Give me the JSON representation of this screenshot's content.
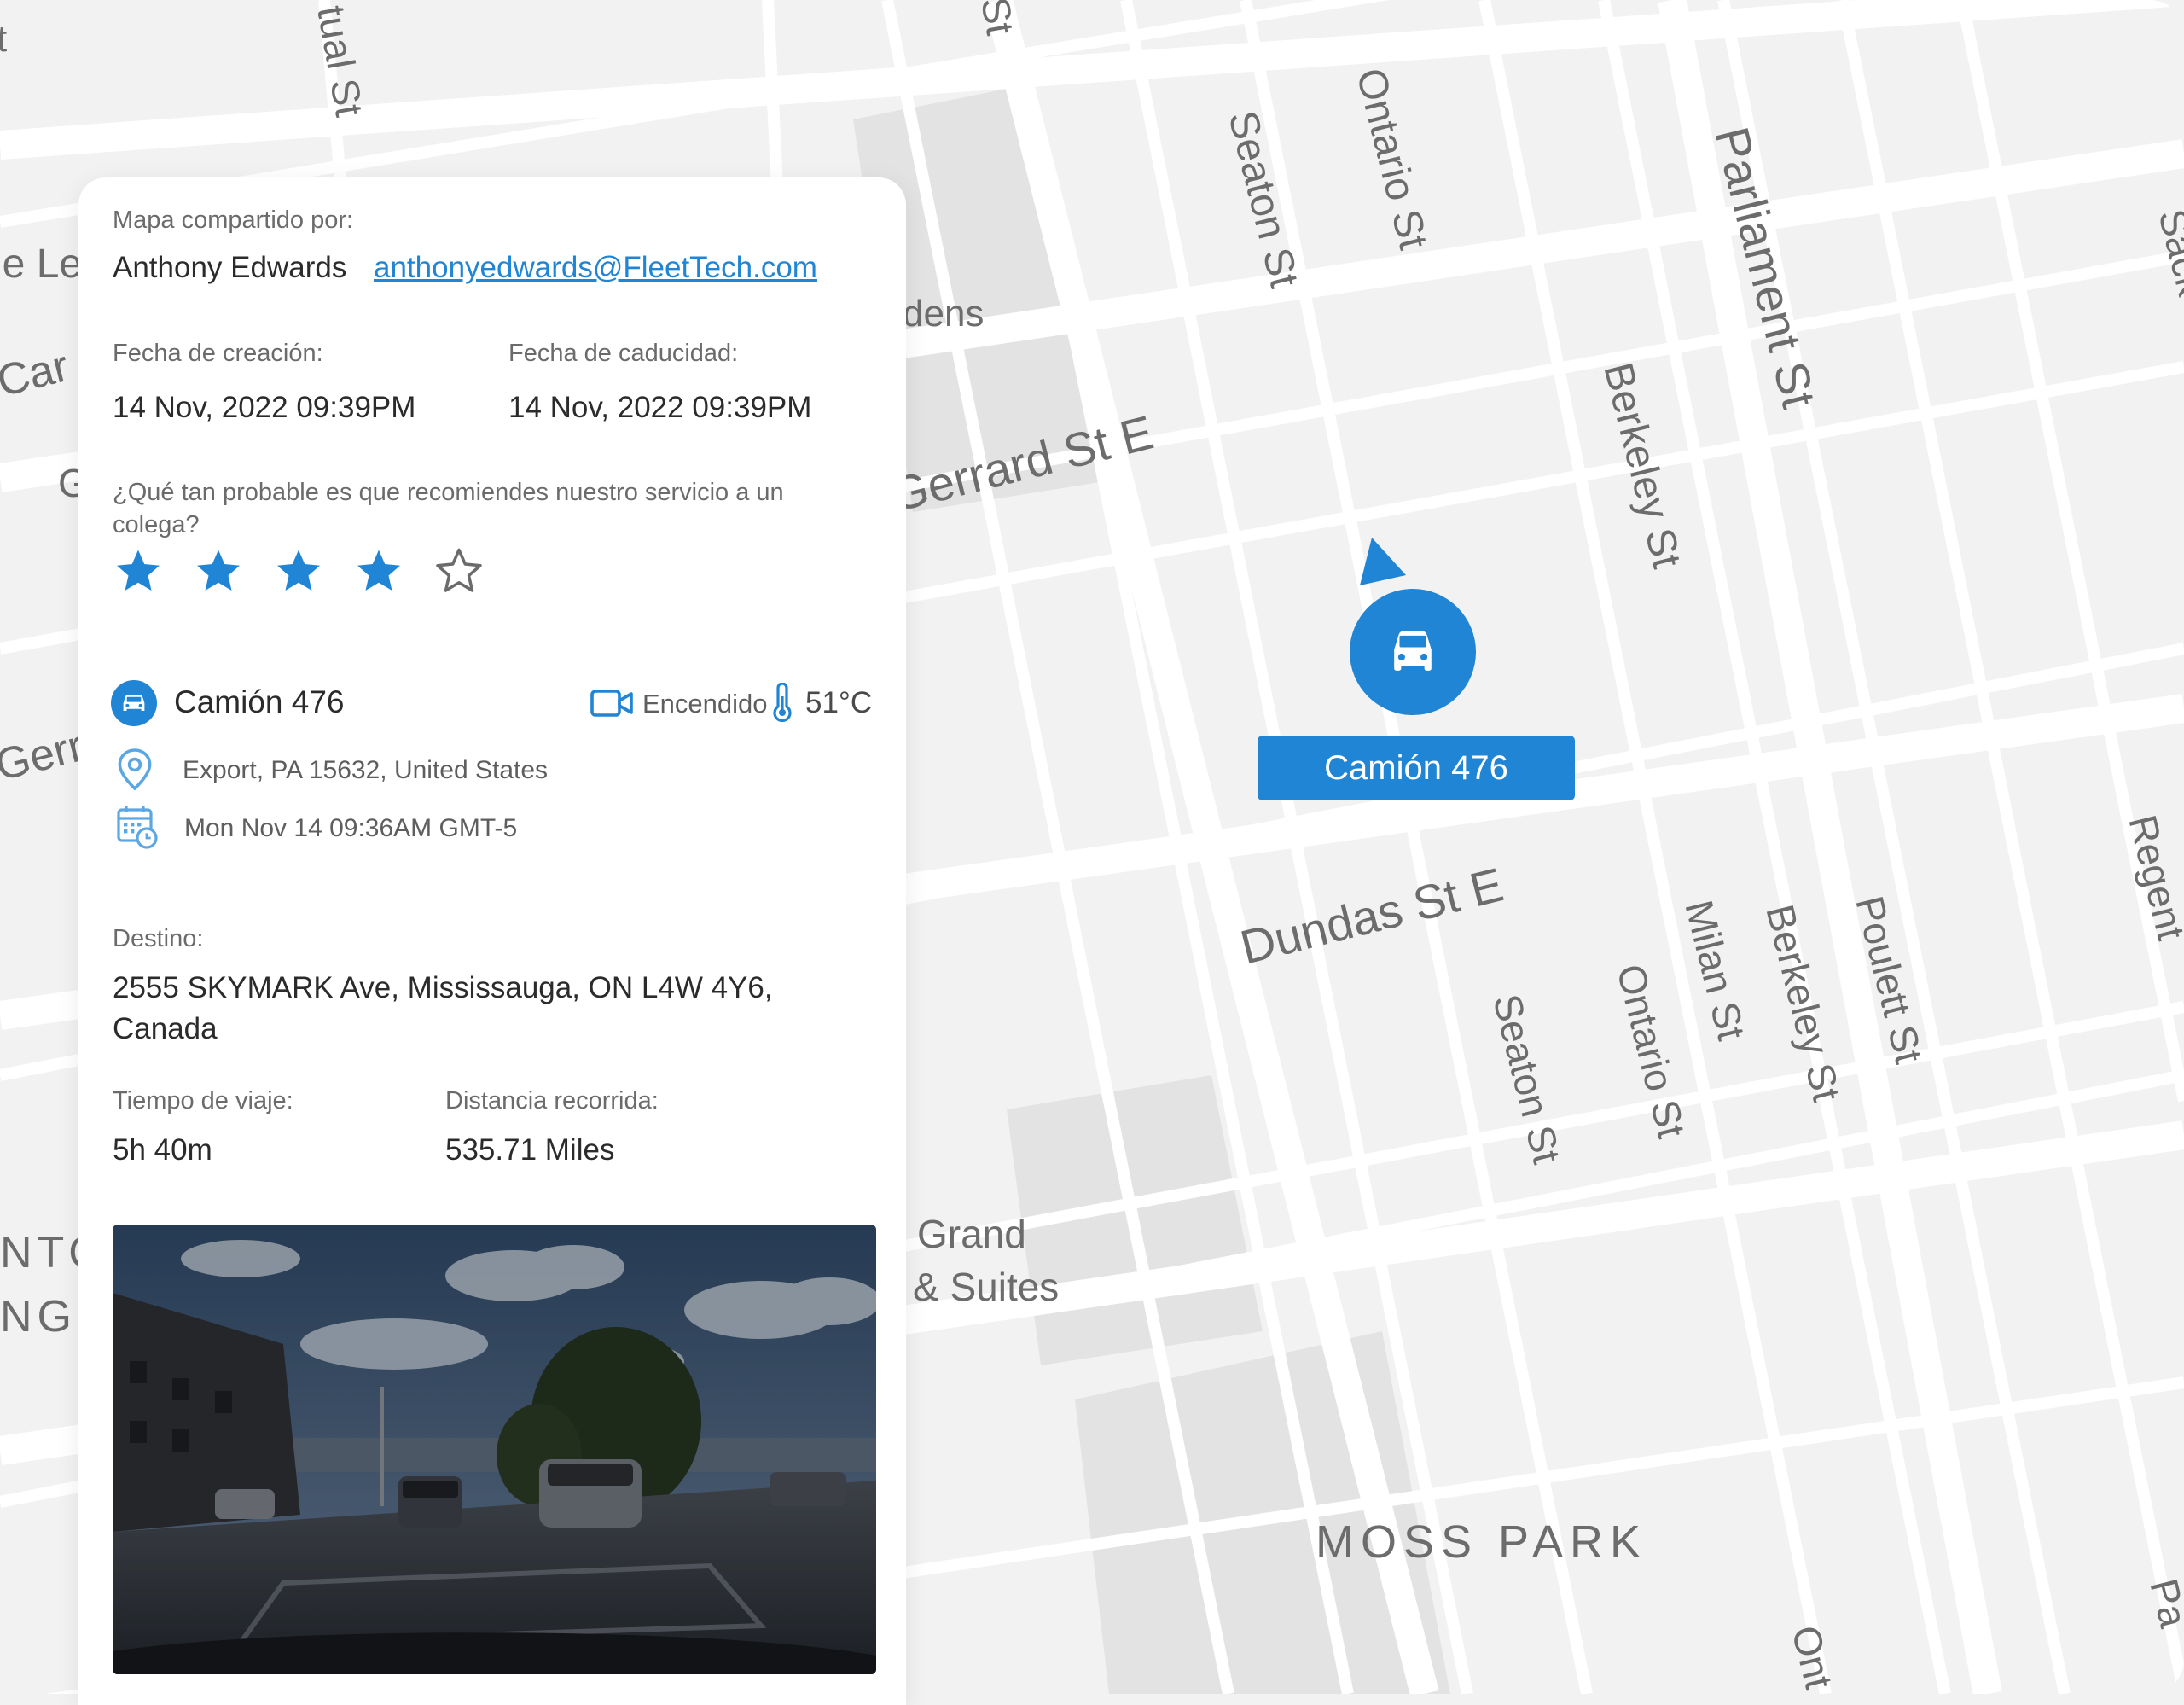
{
  "share": {
    "shared_by_label": "Mapa compartido por:",
    "user_name": "Anthony Edwards",
    "user_email": "anthonyedwards@FleetTech.com"
  },
  "dates": {
    "created_label": "Fecha de creación:",
    "created_value": "14 Nov, 2022 09:39PM",
    "expiry_label": "Fecha de caducidad:",
    "expiry_value": "14 Nov, 2022 09:39PM"
  },
  "rating": {
    "question": "¿Qué tan probable es que recomiendes nuestro servicio a un colega?",
    "value": 4,
    "max": 5
  },
  "vehicle": {
    "name": "Camión 476",
    "camera_status": "Encendido",
    "temperature": "51°C",
    "location": "Export, PA 15632, United States",
    "timestamp": "Mon Nov 14 09:36AM GMT-5"
  },
  "trip": {
    "destination_label": "Destino:",
    "destination_line1": "2555 SKYMARK Ave, Mississauga, ON L4W 4Y6,",
    "destination_line2": "Canada",
    "travel_time_label": "Tiempo de viaje:",
    "travel_time_value": "5h 40m",
    "distance_label": "Distancia recorrida:",
    "distance_value": "535.71 Miles"
  },
  "map": {
    "marker_label": "Camión 476",
    "streets": {
      "gerrard": "Gerrard St E",
      "gerrard_west": "Gerr",
      "dundas": "Dundas St E",
      "seaton": "Seaton St",
      "ontario": "Ontario St",
      "parliament": "Parliament St",
      "berkeley": "Berkeley St",
      "milan": "Milan St",
      "poulett": "Poulett St",
      "regent": "Regent",
      "sack": "Sack",
      "ontario_bottom": "Ont",
      "parliament_bottom": "Pa",
      "mutual": "tual St",
      "st_top": "St",
      "le_left": "le Le",
      "car_left": "Car",
      "g_left": "G",
      "nto_left": "NTO",
      "ng_left": "NG",
      "t_left": "t"
    },
    "places": {
      "gardens": "dens",
      "hotel_line1": "Grand",
      "hotel_line2": "& Suites",
      "moss_park": "MOSS PARK"
    }
  },
  "colors": {
    "accent": "#2185d5",
    "map_background": "#f2f2f2",
    "road": "#ffffff"
  },
  "icons": {
    "vehicle": "car-icon",
    "camera": "video-camera-icon",
    "temperature": "thermometer-icon",
    "location": "location-pin-icon",
    "calendar": "calendar-clock-icon",
    "marker": "navigation-arrow-icon"
  }
}
